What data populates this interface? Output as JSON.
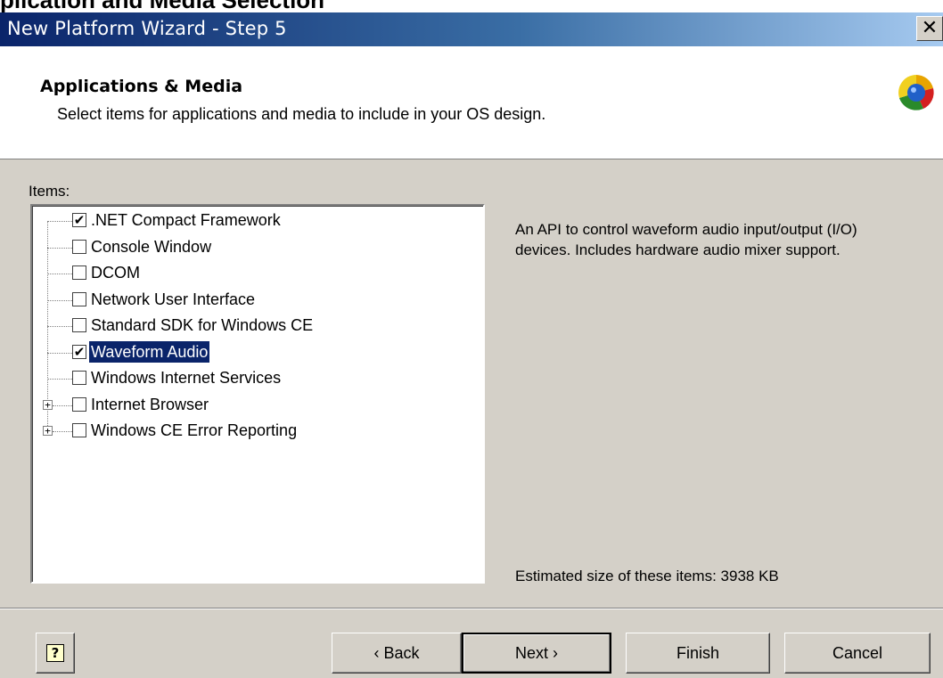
{
  "page_caption": "plication and Media Selection",
  "window": {
    "title": "New Platform Wizard - Step 5",
    "close_glyph": "✕"
  },
  "header": {
    "title": "Applications & Media",
    "subtitle": "Select items for applications and media to include in your OS design.",
    "logo_icon": "wizard-logo-icon"
  },
  "items_label": "Items:",
  "tree": {
    "items": [
      {
        "label": ".NET Compact Framework",
        "checked": true,
        "expandable": false,
        "selected": false
      },
      {
        "label": "Console Window",
        "checked": false,
        "expandable": false,
        "selected": false
      },
      {
        "label": "DCOM",
        "checked": false,
        "expandable": false,
        "selected": false
      },
      {
        "label": "Network User Interface",
        "checked": false,
        "expandable": false,
        "selected": false
      },
      {
        "label": "Standard SDK for Windows CE",
        "checked": false,
        "expandable": false,
        "selected": false
      },
      {
        "label": "Waveform Audio",
        "checked": true,
        "expandable": false,
        "selected": true
      },
      {
        "label": "Windows Internet Services",
        "checked": false,
        "expandable": false,
        "selected": false
      },
      {
        "label": "Internet Browser",
        "checked": false,
        "expandable": true,
        "selected": false
      },
      {
        "label": "Windows CE Error Reporting",
        "checked": false,
        "expandable": true,
        "selected": false
      }
    ]
  },
  "description": "An API to control waveform audio input/output (I/O) devices. Includes hardware audio mixer support.",
  "estimate": "Estimated size of these items: 3938 KB",
  "buttons": {
    "help_glyph": "?",
    "back": "‹ Back",
    "next": "Next ›",
    "finish": "Finish",
    "cancel": "Cancel"
  },
  "colors": {
    "title_bar_start": "#0a246a",
    "title_bar_end": "#a6caf0",
    "dialog_face": "#d4d0c8",
    "selection": "#0a246a"
  }
}
